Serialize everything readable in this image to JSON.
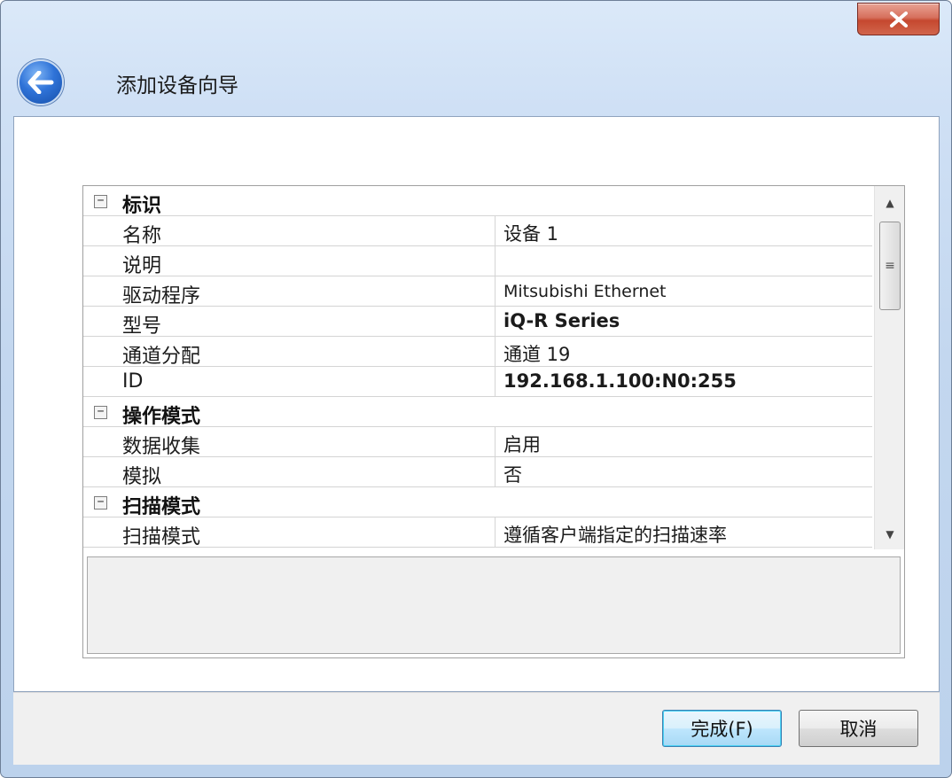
{
  "window": {
    "title": "添加设备向导",
    "close_glyph": "✕"
  },
  "grid": {
    "rows": [
      {
        "kind": "category",
        "toggle": "−",
        "label": "标识"
      },
      {
        "kind": "property",
        "name": "名称",
        "value": "设备 1"
      },
      {
        "kind": "property",
        "name": "说明",
        "value": ""
      },
      {
        "kind": "property",
        "name": "驱动程序",
        "value": "Mitsubishi Ethernet"
      },
      {
        "kind": "property",
        "name": "型号",
        "value": "iQ-R Series"
      },
      {
        "kind": "property",
        "name": "通道分配",
        "value": "通道 19"
      },
      {
        "kind": "property",
        "name": "ID",
        "value": "192.168.1.100:N0:255"
      },
      {
        "kind": "category",
        "toggle": "−",
        "label": "操作模式"
      },
      {
        "kind": "property",
        "name": "数据收集",
        "value": "启用"
      },
      {
        "kind": "property",
        "name": "模拟",
        "value": "否"
      },
      {
        "kind": "category",
        "toggle": "−",
        "label": "扫描模式"
      },
      {
        "kind": "property",
        "name": "扫描模式",
        "value": "遵循客户端指定的扫描速率"
      }
    ],
    "scrollbar": {
      "up": "▲",
      "down": "▼",
      "grip": "≡"
    }
  },
  "buttons": {
    "finish": "完成(F)",
    "cancel": "取消"
  },
  "colors": {
    "window_frame": "#c3d7ef",
    "close_button": "#c5482f",
    "back_button": "#2f73d8"
  },
  "icons": {
    "back": "back-arrow-icon",
    "close": "close-icon"
  }
}
